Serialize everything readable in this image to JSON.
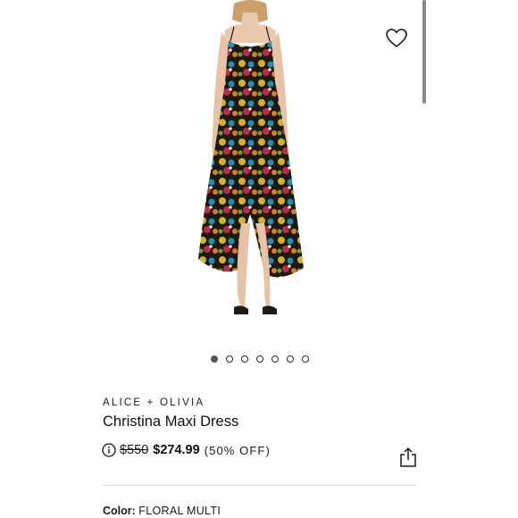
{
  "product": {
    "brand": "ALICE + OLIVIA",
    "name": "Christina Maxi Dress",
    "price_original": "$550",
    "price_sale": "$274.99",
    "discount": "(50% OFF)",
    "color_label": "Color:",
    "color_value": "FLORAL MULTI"
  },
  "carousel": {
    "total": 7,
    "active_index": 0
  },
  "icons": {
    "wishlist": "heart-icon",
    "info": "info-icon",
    "share": "share-icon"
  },
  "colors": {
    "text": "#1a1a1a",
    "dot_active": "#555555",
    "divider": "#d9d9d9"
  }
}
